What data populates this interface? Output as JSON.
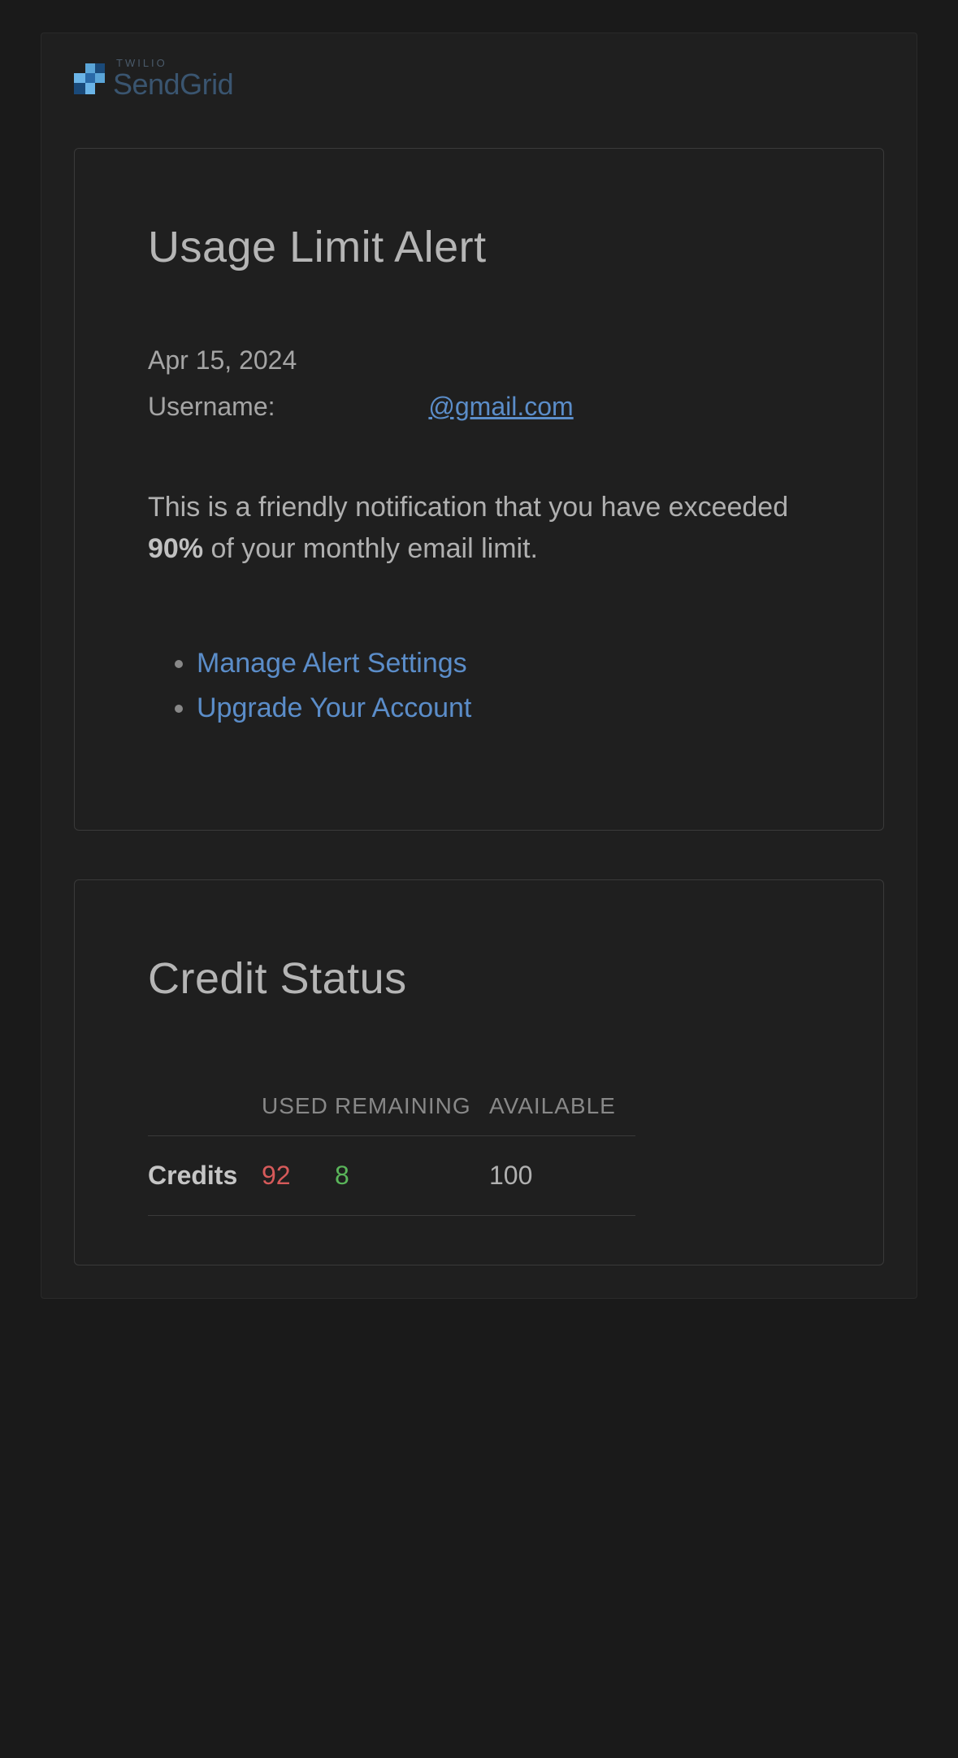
{
  "logo": {
    "twilio": "TWILIO",
    "sendgrid": "SendGrid"
  },
  "alert": {
    "title": "Usage Limit Alert",
    "date": "Apr 15, 2024",
    "username_label": "Username:",
    "username_value": "@gmail.com",
    "msg_part1": "This is a friendly notification that you have exceeded ",
    "msg_percent": "90%",
    "msg_part2": " of your monthly email limit.",
    "links": {
      "manage": "Manage Alert Settings",
      "upgrade": "Upgrade Your Account"
    }
  },
  "credits": {
    "title": "Credit Status",
    "headers": {
      "used": "USED",
      "remaining": "REMAINING",
      "available": "AVAILABLE"
    },
    "row": {
      "label": "Credits",
      "used": "92",
      "remaining": "8",
      "available": "100"
    }
  }
}
